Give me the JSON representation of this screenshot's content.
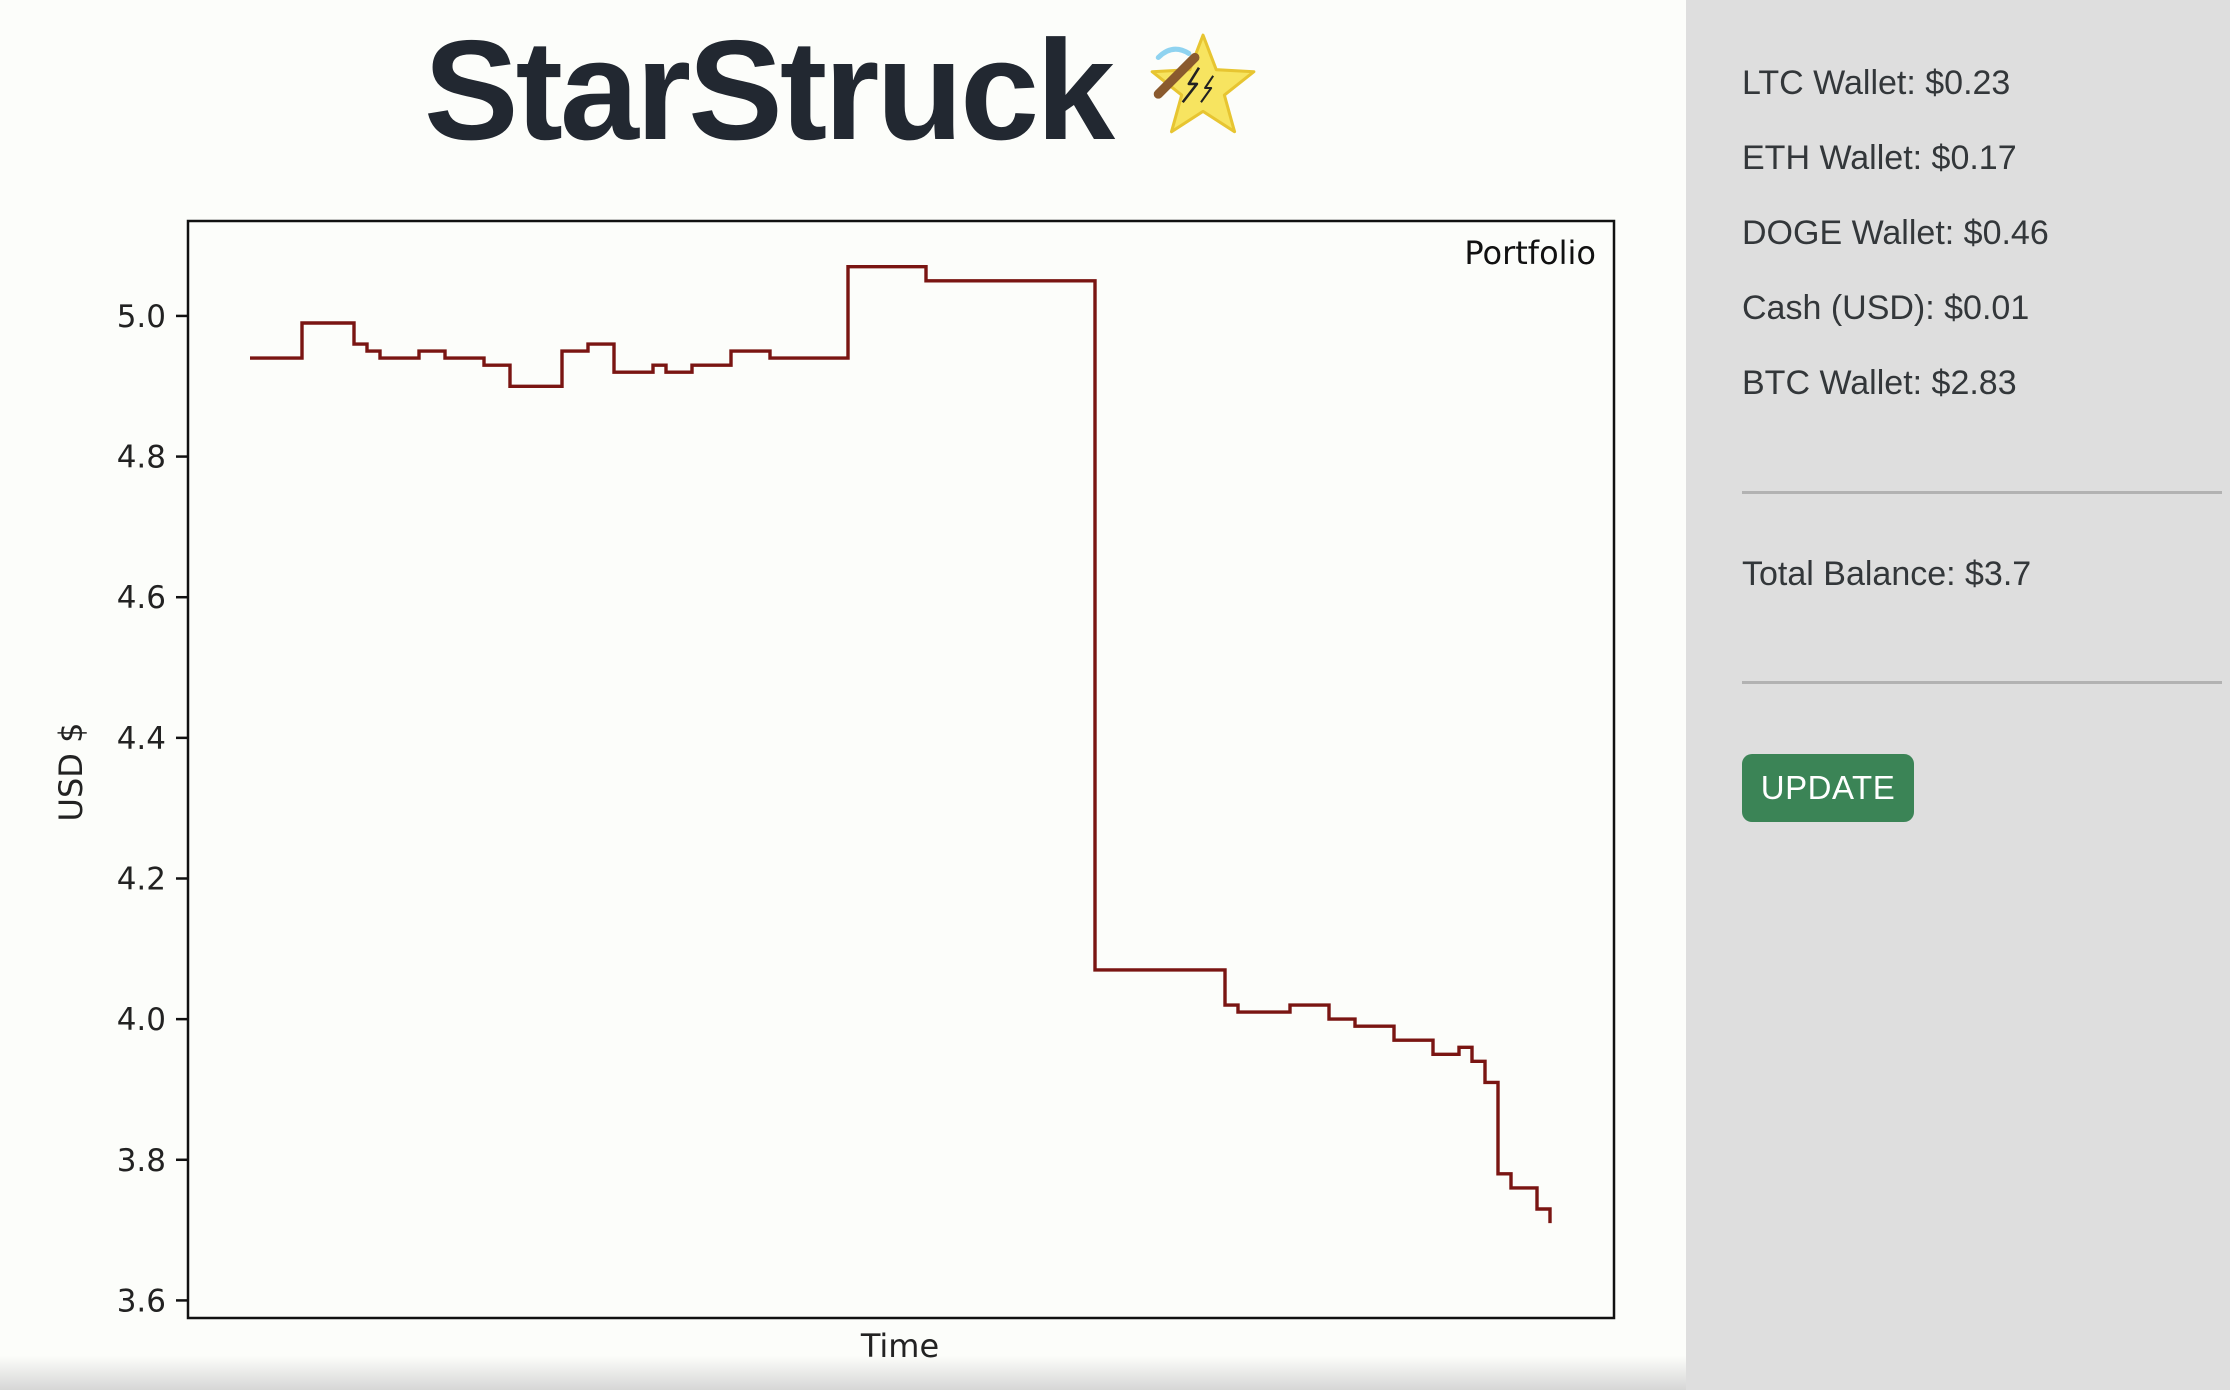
{
  "app": {
    "title": "StarStruck",
    "logo_icon": "shooting-star-icon"
  },
  "sidebar": {
    "wallets": [
      {
        "label": "LTC Wallet: $0.23"
      },
      {
        "label": "ETH Wallet: $0.17"
      },
      {
        "label": "DOGE Wallet: $0.46"
      },
      {
        "label": "Cash (USD): $0.01"
      },
      {
        "label": "BTC Wallet: $2.83"
      }
    ],
    "total_balance": "Total Balance: $3.7",
    "update_button": "UPDATE"
  },
  "colors": {
    "accent_button": "#3b8456",
    "line": "#7a1512",
    "sidebar_bg": "#dedede"
  },
  "chart_data": {
    "type": "line",
    "legend": "Portfolio",
    "legend_position": "top-right",
    "xlabel": "Time",
    "ylabel": "USD $",
    "ylim": [
      3.575,
      5.135
    ],
    "yticks": [
      "3.6",
      "3.8",
      "4.0",
      "4.2",
      "4.4",
      "4.6",
      "4.8",
      "5.0"
    ],
    "grid": false,
    "series": [
      {
        "name": "Portfolio",
        "x": [
          0,
          3,
          4,
          6,
          8,
          9,
          10,
          11,
          13,
          14,
          15,
          16,
          18,
          20,
          22,
          24,
          24.5,
          26,
          27,
          28,
          29,
          31,
          32,
          33,
          34,
          36,
          37,
          40,
          41,
          42,
          43,
          44,
          45,
          46,
          47,
          48,
          49,
          50,
          51,
          52,
          53,
          54,
          55,
          56,
          57,
          58,
          59,
          60,
          61,
          62,
          63,
          65,
          66,
          67,
          68,
          69,
          70,
          71,
          72,
          73,
          74,
          75,
          76,
          77,
          78,
          79,
          80,
          81,
          82,
          83,
          84,
          85,
          86,
          87,
          88,
          89,
          90,
          91,
          92,
          93,
          94,
          95,
          96,
          97,
          98,
          99,
          100
        ],
        "y": [
          4.94,
          4.94,
          4.99,
          4.99,
          4.96,
          4.95,
          4.94,
          4.94,
          4.95,
          4.95,
          4.94,
          4.94,
          4.93,
          4.9,
          4.9,
          4.95,
          4.95,
          4.96,
          4.96,
          4.92,
          4.92,
          4.93,
          4.92,
          4.92,
          4.93,
          4.93,
          4.95,
          4.94,
          4.94,
          4.94,
          4.94,
          4.94,
          4.94,
          5.07,
          5.07,
          5.07,
          5.07,
          5.07,
          5.07,
          5.05,
          5.05,
          5.05,
          5.05,
          5.05,
          5.05,
          5.05,
          5.05,
          5.05,
          5.05,
          5.05,
          5.05,
          4.07,
          4.07,
          4.07,
          4.07,
          4.07,
          4.07,
          4.07,
          4.07,
          4.07,
          4.07,
          4.02,
          4.01,
          4.01,
          4.01,
          4.01,
          4.02,
          4.02,
          4.02,
          4.0,
          4.0,
          3.99,
          3.99,
          3.99,
          3.97,
          3.97,
          3.97,
          3.95,
          3.95,
          3.96,
          3.94,
          3.91,
          3.78,
          3.76,
          3.76,
          3.73,
          3.71
        ]
      }
    ]
  }
}
